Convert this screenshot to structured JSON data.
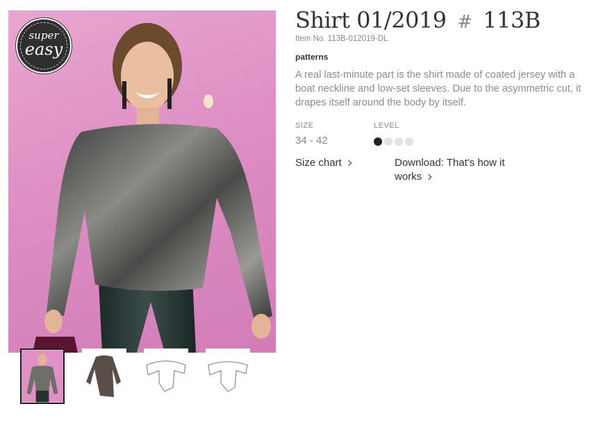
{
  "product": {
    "title_name": "Shirt 01/2019",
    "title_hash": "#",
    "title_code": "113B",
    "item_no": "Item No. 113B-012019-DL",
    "category": "patterns",
    "description": "A real last-minute part is the shirt made of coated jersey with a boat neckline and low-set sleeves. Due to the asymmetric cut, it drapes itself around the body by itself."
  },
  "badge": {
    "top": "super",
    "bottom": "easy"
  },
  "specs": {
    "size_label": "SIZE",
    "size_value": "34 - 42",
    "level_label": "LEVEL",
    "level": 1,
    "level_max": 4
  },
  "links": {
    "size_chart": "Size chart",
    "download": "Download: That's how it works"
  },
  "gallery": {
    "thumbnails": [
      "model-photo",
      "shirt-photo",
      "front-sketch",
      "back-sketch"
    ],
    "active_index": 0
  },
  "colors": {
    "background_pink": "#de8fc4",
    "level_filled": "#222222",
    "level_empty": "#e2e2e2",
    "text_muted": "#8c8c8c"
  }
}
